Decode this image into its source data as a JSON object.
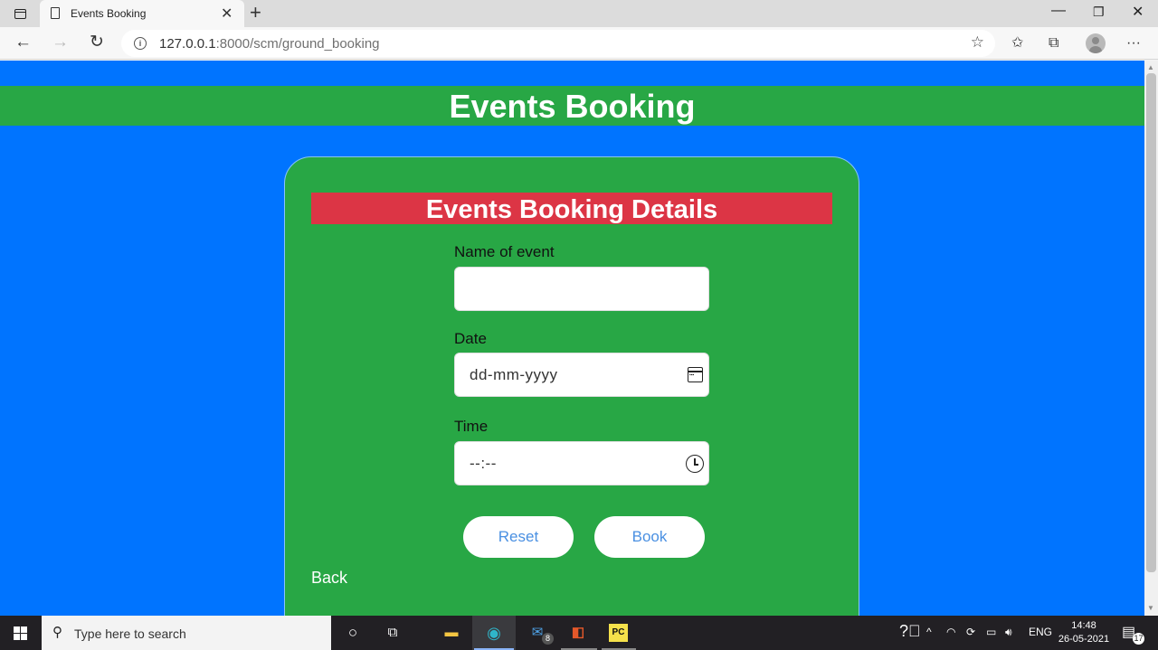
{
  "browser": {
    "tab_title": "Events Booking",
    "url_host": "127.0.0.1",
    "url_rest": ":8000/scm/ground_booking"
  },
  "page": {
    "header_title": "Events Booking",
    "card_title": "Events Booking Details",
    "fields": {
      "event_name_label": "Name of event",
      "event_name_value": "",
      "date_label": "Date",
      "date_value": "dd-mm-yyyy",
      "time_label": "Time",
      "time_value": "--:--"
    },
    "reset_label": "Reset",
    "book_label": "Book",
    "back_label": "Back"
  },
  "taskbar": {
    "search_placeholder": "Type here to search",
    "mail_badge": "8",
    "language": "ENG",
    "time": "14:48",
    "date": "26-05-2021",
    "notification_count": "17"
  },
  "colors": {
    "page_background": "#0074ff",
    "header_band": "#28a745",
    "card": "#28a745",
    "card_banner": "#dc3545",
    "button_text": "#4a90e2"
  }
}
